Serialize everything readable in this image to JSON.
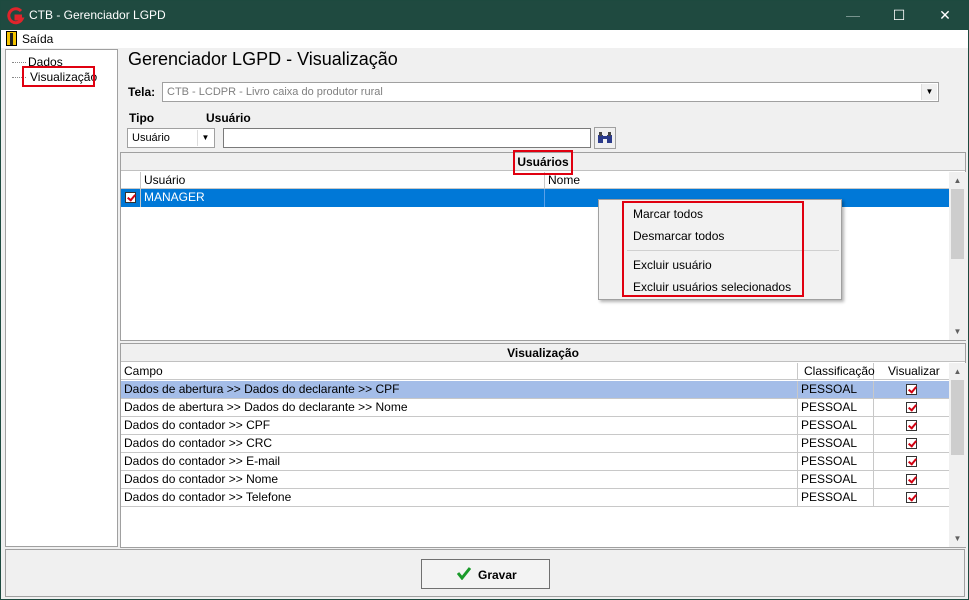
{
  "window": {
    "title": "CTB - Gerenciador LGPD",
    "minimize_glyph": "—",
    "maximize_glyph": "☐",
    "close_glyph": "✕"
  },
  "menu": {
    "exit_label": "Saída",
    "exit_icon": "door-exit-icon"
  },
  "tree": {
    "items": [
      {
        "label": "Dados"
      },
      {
        "label": "Visualização",
        "selected": true
      }
    ]
  },
  "page": {
    "heading": "Gerenciador LGPD - Visualização"
  },
  "filters": {
    "screen_label": "Tela:",
    "screen_value": "CTB - LCDPR - Livro caixa do produtor rural",
    "type_label": "Tipo",
    "type_value": "Usuário",
    "user_label": "Usuário",
    "user_value": "",
    "search_icon": "binoculars-icon"
  },
  "users_panel": {
    "title": "Usuários",
    "columns": [
      "Usuário",
      "Nome"
    ],
    "rows": [
      {
        "checked": true,
        "user": "MANAGER",
        "name": ""
      }
    ]
  },
  "context_menu": {
    "items": [
      "Marcar todos",
      "Desmarcar todos",
      "Excluir usuário",
      "Excluir usuários selecionados"
    ]
  },
  "view_panel": {
    "title": "Visualização",
    "columns": [
      "Campo",
      "Classificação",
      "Visualizar"
    ],
    "rows": [
      {
        "field": "Dados de abertura >>  Dados do declarante  >> CPF",
        "classification": "PESSOAL",
        "visible": true
      },
      {
        "field": "Dados de abertura >>  Dados do declarante  >> Nome",
        "classification": "PESSOAL",
        "visible": true
      },
      {
        "field": "Dados do contador >> CPF",
        "classification": "PESSOAL",
        "visible": true
      },
      {
        "field": "Dados do contador >> CRC",
        "classification": "PESSOAL",
        "visible": true
      },
      {
        "field": "Dados do contador >> E-mail",
        "classification": "PESSOAL",
        "visible": true
      },
      {
        "field": "Dados do contador >> Nome",
        "classification": "PESSOAL",
        "visible": true
      },
      {
        "field": "Dados do contador >> Telefone",
        "classification": "PESSOAL",
        "visible": true
      }
    ]
  },
  "footer": {
    "save_label": "Gravar",
    "save_icon": "green-check-icon"
  },
  "colors": {
    "titlebar": "#1f4a40",
    "selection": "#0078d7",
    "row_highlight": "#a4bde8",
    "annotation": "#e00010"
  }
}
